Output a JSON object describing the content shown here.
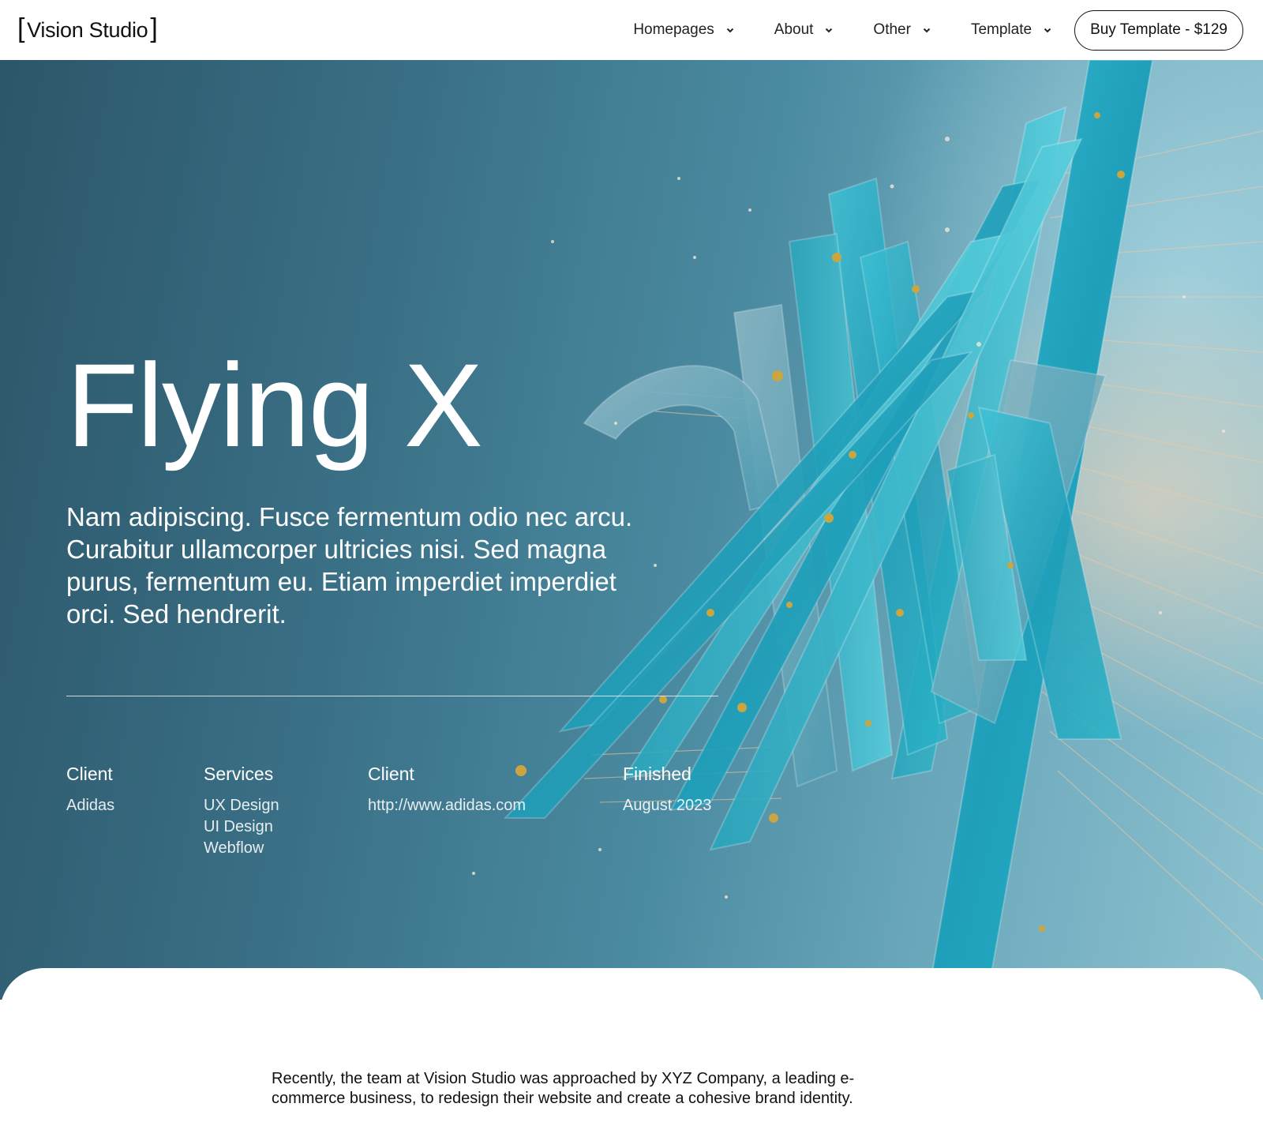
{
  "nav": {
    "logo_open": "[",
    "logo_text": "Vision Studio",
    "logo_close": "]",
    "items": [
      {
        "label": "Homepages"
      },
      {
        "label": "About"
      },
      {
        "label": "Other"
      },
      {
        "label": "Template"
      }
    ],
    "cta_label": "Buy Template - $129"
  },
  "hero": {
    "title": "Flying X",
    "description": "Nam adipiscing. Fusce fermentum odio nec arcu. Curabitur ullamcorper ultricies nisi. Sed magna purus, fermentum eu. Etiam imperdiet imperdiet orci. Sed hendrerit.",
    "meta": [
      {
        "label": "Client",
        "values": [
          "Adidas"
        ]
      },
      {
        "label": "Services",
        "values": [
          "UX Design",
          "UI Design",
          "Webflow"
        ]
      },
      {
        "label": "Client",
        "values": [
          "http://www.adidas.com"
        ]
      },
      {
        "label": "Finished",
        "values": [
          "August 2023"
        ]
      }
    ]
  },
  "content": {
    "intro": "Recently, the team at Vision Studio was approached by XYZ Company, a leading e-commerce business, to redesign their website and create a cohesive brand identity."
  },
  "colors": {
    "hero_dark": "#2c5669",
    "hero_mid": "#4a8aa0",
    "ribbon_cyan": "#29b6cc",
    "accent_peach": "#f5c9a0"
  },
  "icons": {
    "dropdown": "chevron-down-icon",
    "hero_image": "abstract-ribbon-sculpture"
  }
}
